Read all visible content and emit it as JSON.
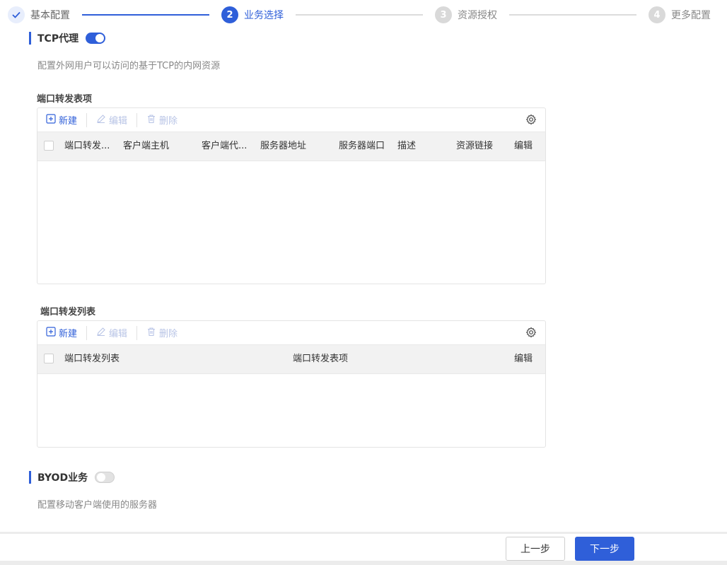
{
  "stepper": {
    "steps": [
      {
        "number": "✓",
        "label": "基本配置",
        "state": "done"
      },
      {
        "number": "2",
        "label": "业务选择",
        "state": "active"
      },
      {
        "number": "3",
        "label": "资源授权",
        "state": "todo"
      },
      {
        "number": "4",
        "label": "更多配置",
        "state": "todo"
      }
    ]
  },
  "tcp": {
    "title": "TCP代理",
    "toggle": "on",
    "description": "配置外网用户可以访问的基于TCP的内网资源"
  },
  "port_items": {
    "title": "端口转发表项",
    "toolbar": {
      "new": "新建",
      "edit": "编辑",
      "delete": "删除"
    },
    "columns": [
      "端口转发...",
      "客户端主机",
      "客户端代...",
      "服务器地址",
      "服务器端口",
      "描述",
      "资源链接",
      "编辑"
    ]
  },
  "port_list": {
    "title": "端口转发列表",
    "toolbar": {
      "new": "新建",
      "edit": "编辑",
      "delete": "删除"
    },
    "columns": [
      "端口转发列表",
      "端口转发表项",
      "编辑"
    ]
  },
  "byod": {
    "title": "BYOD业务",
    "toggle": "off",
    "description": "配置移动客户端使用的服务器"
  },
  "footer": {
    "prev": "上一步",
    "next": "下一步"
  },
  "colors": {
    "accent": "#2f5fd9",
    "disabled": "#b8c4e6",
    "header_bg": "#f2f2f2"
  }
}
